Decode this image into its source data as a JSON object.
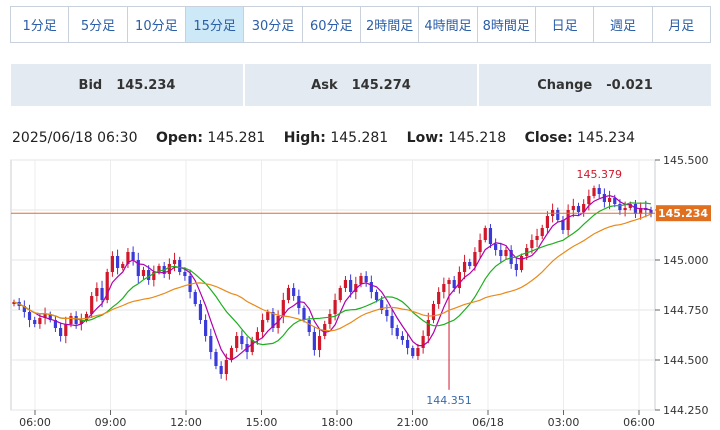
{
  "timeframes": [
    {
      "label": "1分足",
      "active": false
    },
    {
      "label": "5分足",
      "active": false
    },
    {
      "label": "10分足",
      "active": false
    },
    {
      "label": "15分足",
      "active": true
    },
    {
      "label": "30分足",
      "active": false
    },
    {
      "label": "60分足",
      "active": false
    },
    {
      "label": "2時間足",
      "active": false
    },
    {
      "label": "4時間足",
      "active": false
    },
    {
      "label": "8時間足",
      "active": false
    },
    {
      "label": "日足",
      "active": false
    },
    {
      "label": "週足",
      "active": false
    },
    {
      "label": "月足",
      "active": false
    }
  ],
  "quote": {
    "bid_label": "Bid",
    "bid_value": "145.234",
    "ask_label": "Ask",
    "ask_value": "145.274",
    "change_label": "Change",
    "change_value": "-0.021"
  },
  "ohlc": {
    "datetime": "2025/06/18 06:30",
    "open_label": "Open:",
    "open": "145.281",
    "high_label": "High:",
    "high": "145.281",
    "low_label": "Low:",
    "low": "145.218",
    "close_label": "Close:",
    "close": "145.234"
  },
  "colors": {
    "up": "#d0182a",
    "down": "#3a3ad8",
    "ma_short": "#b000b0",
    "ma_mid": "#1fae1f",
    "ma_long": "#e98a1a",
    "price_line": "#e07020",
    "annotation_high": "#d0182a",
    "annotation_low": "#3a6aa8"
  },
  "chart_data": {
    "type": "candlestick",
    "yticks": [
      "145.500",
      "145.250",
      "145.000",
      "144.750",
      "144.500",
      "144.250"
    ],
    "ylim": [
      144.25,
      145.5
    ],
    "xticks": [
      "06:00",
      "09:00",
      "12:00",
      "15:00",
      "18:00",
      "21:00",
      "06/18",
      "03:00",
      "06:00"
    ],
    "grid": true,
    "current_price": "145.234",
    "max_label": "145.379",
    "min_label": "144.351",
    "close": [
      144.79,
      144.77,
      144.74,
      144.7,
      144.68,
      144.71,
      144.73,
      144.7,
      144.66,
      144.62,
      144.68,
      144.72,
      144.68,
      144.7,
      144.73,
      144.82,
      144.86,
      144.8,
      144.94,
      145.02,
      144.96,
      144.98,
      145.04,
      145.0,
      144.92,
      144.95,
      144.9,
      144.94,
      144.97,
      144.93,
      144.98,
      145.0,
      144.94,
      144.92,
      144.84,
      144.78,
      144.7,
      144.62,
      144.54,
      144.47,
      144.43,
      144.5,
      144.56,
      144.62,
      144.58,
      144.54,
      144.6,
      144.64,
      144.7,
      144.74,
      144.66,
      144.72,
      144.8,
      144.86,
      144.82,
      144.76,
      144.7,
      144.64,
      144.55,
      144.62,
      144.68,
      144.73,
      144.8,
      144.86,
      144.9,
      144.84,
      144.88,
      144.92,
      144.89,
      144.84,
      144.8,
      144.75,
      144.72,
      144.66,
      144.62,
      144.6,
      144.56,
      144.52,
      144.56,
      144.62,
      144.7,
      144.78,
      144.84,
      144.88,
      144.9,
      144.86,
      144.94,
      144.99,
      144.97,
      145.04,
      145.1,
      145.16,
      145.08,
      145.05,
      145.02,
      145.05,
      144.98,
      144.95,
      145.02,
      145.06,
      145.1,
      145.12,
      145.16,
      145.22,
      145.25,
      145.2,
      145.15,
      145.25,
      145.27,
      145.24,
      145.28,
      145.32,
      145.36,
      145.33,
      145.29,
      145.31,
      145.28,
      145.25,
      145.26,
      145.28,
      145.23,
      145.26,
      145.25,
      145.23
    ]
  }
}
